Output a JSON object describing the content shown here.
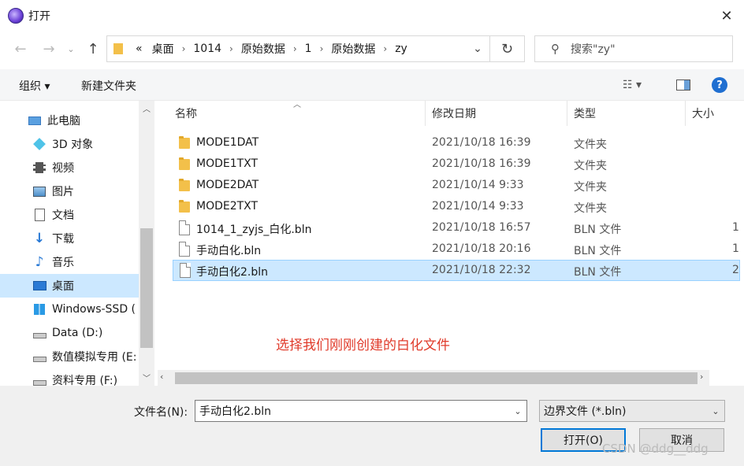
{
  "window": {
    "title": "打开"
  },
  "address": {
    "segments": [
      "«",
      "桌面",
      "1014",
      "原始数据",
      "1",
      "原始数据",
      "zy"
    ]
  },
  "search": {
    "placeholder": "搜索\"zy\""
  },
  "toolbar": {
    "organize": "组织 ▾",
    "new_folder": "新建文件夹"
  },
  "sidebar": {
    "items": [
      {
        "label": "此电脑",
        "icon": "computer-icon"
      },
      {
        "label": "3D 对象",
        "icon": "cube-icon"
      },
      {
        "label": "视频",
        "icon": "film-icon"
      },
      {
        "label": "图片",
        "icon": "picture-icon"
      },
      {
        "label": "文档",
        "icon": "document-icon"
      },
      {
        "label": "下载",
        "icon": "download-icon"
      },
      {
        "label": "音乐",
        "icon": "music-icon"
      },
      {
        "label": "桌面",
        "icon": "desktop-icon"
      },
      {
        "label": "Windows-SSD (",
        "icon": "windows-drive-icon"
      },
      {
        "label": "Data (D:)",
        "icon": "drive-icon"
      },
      {
        "label": "数值模拟专用 (E:",
        "icon": "drive-icon"
      },
      {
        "label": "资料专用 (F:)",
        "icon": "drive-icon"
      }
    ]
  },
  "columns": {
    "name": "名称",
    "date": "修改日期",
    "type": "类型",
    "size": "大小"
  },
  "files": [
    {
      "name": "MODE1DAT",
      "date": "2021/10/18 16:39",
      "type": "文件夹",
      "size": "",
      "kind": "folder"
    },
    {
      "name": "MODE1TXT",
      "date": "2021/10/18 16:39",
      "type": "文件夹",
      "size": "",
      "kind": "folder"
    },
    {
      "name": "MODE2DAT",
      "date": "2021/10/14 9:33",
      "type": "文件夹",
      "size": "",
      "kind": "folder"
    },
    {
      "name": "MODE2TXT",
      "date": "2021/10/14 9:33",
      "type": "文件夹",
      "size": "",
      "kind": "folder"
    },
    {
      "name": "1014_1_zyjs_白化.bln",
      "date": "2021/10/18 16:57",
      "type": "BLN 文件",
      "size": "1",
      "kind": "file"
    },
    {
      "name": "手动白化.bln",
      "date": "2021/10/18 20:16",
      "type": "BLN 文件",
      "size": "1",
      "kind": "file"
    },
    {
      "name": "手动白化2.bln",
      "date": "2021/10/18 22:32",
      "type": "BLN 文件",
      "size": "2",
      "kind": "file"
    }
  ],
  "annotation": "选择我们刚刚创建的白化文件",
  "bottom": {
    "filename_label": "文件名(N):",
    "filename_value": "手动白化2.bln",
    "filetype": "边界文件 (*.bln)",
    "open": "打开(O)",
    "cancel": "取消"
  },
  "watermark": "CSDN @ddg__ddg"
}
